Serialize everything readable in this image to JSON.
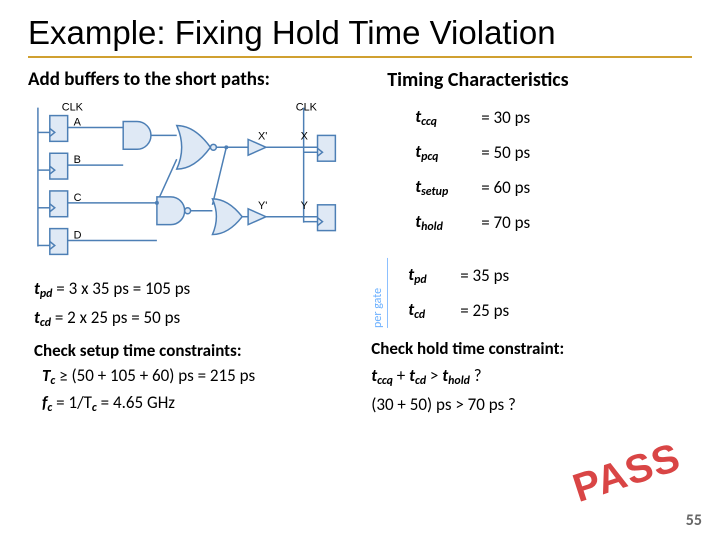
{
  "title": "Example: Fixing Hold Time Violation",
  "left_head": "Add buffers to the short paths:",
  "right_head": "Timing Characteristics",
  "diagram": {
    "inputs": [
      "A",
      "B",
      "C",
      "D"
    ],
    "clock": "CLK",
    "intermediates": [
      "X'",
      "X",
      "Y'",
      "Y"
    ]
  },
  "timing_table": [
    {
      "name": "t",
      "sub": "ccq",
      "val": "= 30 ps"
    },
    {
      "name": "t",
      "sub": "pcq",
      "val": "= 50 ps"
    },
    {
      "name": "t",
      "sub": "setup",
      "val": "= 60 ps"
    },
    {
      "name": "t",
      "sub": "hold",
      "val": "= 70 ps"
    }
  ],
  "per_gate_label": "per gate",
  "per_gate": [
    {
      "name": "t",
      "sub": "pd",
      "val": "= 35 ps"
    },
    {
      "name": "t",
      "sub": "cd",
      "val": "= 25 ps"
    }
  ],
  "calc_tpd_sym": "t",
  "calc_tpd_sub": "pd",
  "calc_tpd_rest": " = 3 x 35 ps = 105 ps",
  "calc_tcd_sym": "t",
  "calc_tcd_sub": "cd",
  "calc_tcd_rest": " = 2 x 25 ps = 50 ps",
  "setup_head": "Check setup time constraints:",
  "setup_1a": "T",
  "setup_1a_sub": "c",
  "setup_1b": " ≥ (50 + 105 + 60) ps = 215 ps",
  "setup_2a": "f",
  "setup_2a_sub": "c",
  "setup_2b": " = 1/T",
  "setup_2b_sub": "c",
  "setup_2c": " = 4.65 GHz",
  "hold_head": "Check hold time constraint:",
  "hold_1": "t<sub>ccq</sub> + t<sub>cd</sub> > t<sub>hold</sub> ?",
  "hold_2": "(30 + 50) ps > 70 ps ?",
  "pass": "PASS",
  "pagenum": "55"
}
